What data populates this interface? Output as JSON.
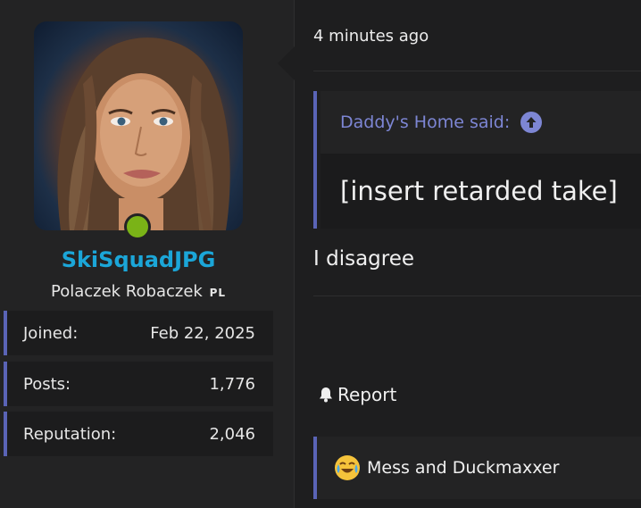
{
  "user": {
    "username": "SkiSquadJPG",
    "title": "Polaczek Robaczek",
    "title_flag": "PL",
    "online": true,
    "stats": [
      {
        "label": "Joined:",
        "value": "Feb 22, 2025"
      },
      {
        "label": "Posts:",
        "value": "1,776"
      },
      {
        "label": "Reputation:",
        "value": "2,046"
      }
    ]
  },
  "post": {
    "time": "4 minutes ago",
    "quote": {
      "author_line": "Daddy's Home said:",
      "text": "[insert retarded take]"
    },
    "body": "I disagree",
    "report_label": "Report",
    "reactions_text": "Mess and Duckmaxxer"
  },
  "colors": {
    "accent": "#5a64b6",
    "username": "#1ba6d8",
    "online": "#7ab317",
    "quote_author": "#7d86d4"
  },
  "icons": [
    "bell-icon",
    "arrow-up-circle-icon",
    "crying-laughing-emoji-icon"
  ]
}
